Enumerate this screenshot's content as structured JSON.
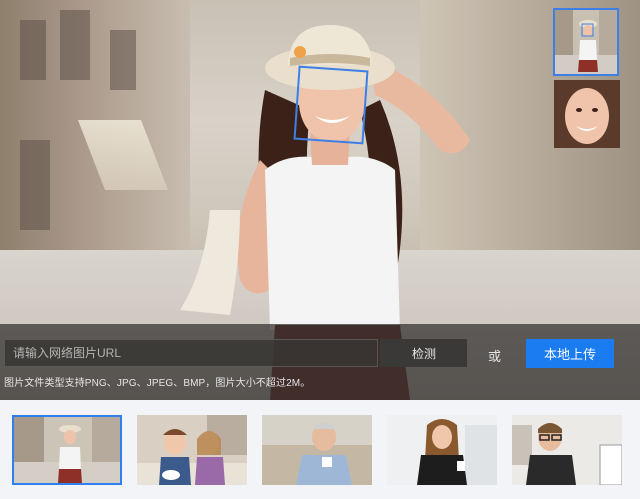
{
  "url_search": {
    "placeholder": "请输入网络图片URL",
    "detect_label": "检测",
    "or_label": "或",
    "upload_label": "本地上传",
    "hint": "图片文件类型支持PNG、JPG、JPEG、BMP，图片大小不超过2M。"
  },
  "colors": {
    "accent": "#1a7cf0",
    "face_box": "#3d7fe6",
    "thumb_selected": "#2f80ed"
  },
  "thumbnails": {
    "selected_index": 0,
    "count": 5
  }
}
